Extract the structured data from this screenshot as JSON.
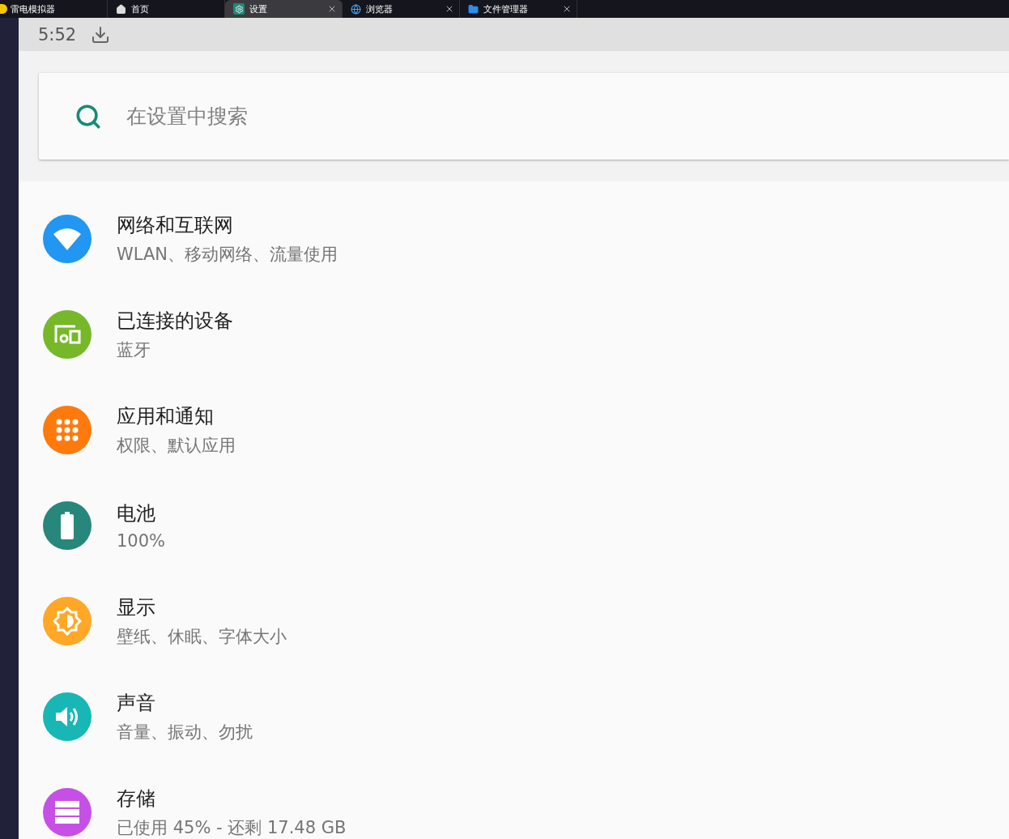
{
  "emulator": {
    "title": "雷电模拟器",
    "tabs": [
      {
        "label": "首页",
        "kind": "home",
        "selected": false,
        "closable": false
      },
      {
        "label": "设置",
        "kind": "settings",
        "selected": true,
        "closable": true
      },
      {
        "label": "浏览器",
        "kind": "browser",
        "selected": false,
        "closable": true
      },
      {
        "label": "文件管理器",
        "kind": "files",
        "selected": false,
        "closable": true
      }
    ]
  },
  "status_bar": {
    "time": "5:52"
  },
  "search": {
    "placeholder": "在设置中搜索"
  },
  "settings": [
    {
      "kind": "network",
      "color": "#2196f3",
      "title": "网络和互联网",
      "subtitle": "WLAN、移动网络、流量使用"
    },
    {
      "kind": "devices",
      "color": "#76b82a",
      "title": "已连接的设备",
      "subtitle": "蓝牙"
    },
    {
      "kind": "apps",
      "color": "#ff7a0d",
      "title": "应用和通知",
      "subtitle": "权限、默认应用"
    },
    {
      "kind": "battery",
      "color": "#26877a",
      "title": "电池",
      "subtitle": "100%"
    },
    {
      "kind": "display",
      "color": "#ffa726",
      "title": "显示",
      "subtitle": "壁纸、休眠、字体大小"
    },
    {
      "kind": "sound",
      "color": "#18b7b5",
      "title": "声音",
      "subtitle": "音量、振动、勿扰"
    },
    {
      "kind": "storage",
      "color": "#c650e6",
      "title": "存储",
      "subtitle": "已使用 45% - 还剩 17.48 GB"
    }
  ]
}
